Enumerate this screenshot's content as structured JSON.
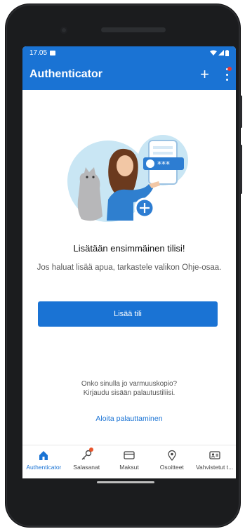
{
  "status_bar": {
    "time": "17.05"
  },
  "app_bar": {
    "title": "Authenticator",
    "add_label": "+"
  },
  "main": {
    "heading": "Lisätään ensimmäinen tilisi!",
    "help_text": "Jos haluat lisää apua, tarkastele valikon Ohje-osaa.",
    "add_account_button": "Lisää tili",
    "backup_question": "Onko sinulla jo varmuuskopio?",
    "backup_instruction": "Kirjaudu sisään palautustiliisi.",
    "restore_link": "Aloita palauttaminen"
  },
  "bottom_nav": {
    "items": [
      {
        "label": "Authenticator",
        "icon": "home-icon"
      },
      {
        "label": "Salasanat",
        "icon": "key-icon"
      },
      {
        "label": "Maksut",
        "icon": "card-icon"
      },
      {
        "label": "Osoitteet",
        "icon": "location-icon"
      },
      {
        "label": "Vahvistetut t...",
        "icon": "id-card-icon"
      }
    ]
  },
  "colors": {
    "accent": "#1a73d4",
    "notification_dot": "#e53935",
    "badge": "#e8542b"
  }
}
